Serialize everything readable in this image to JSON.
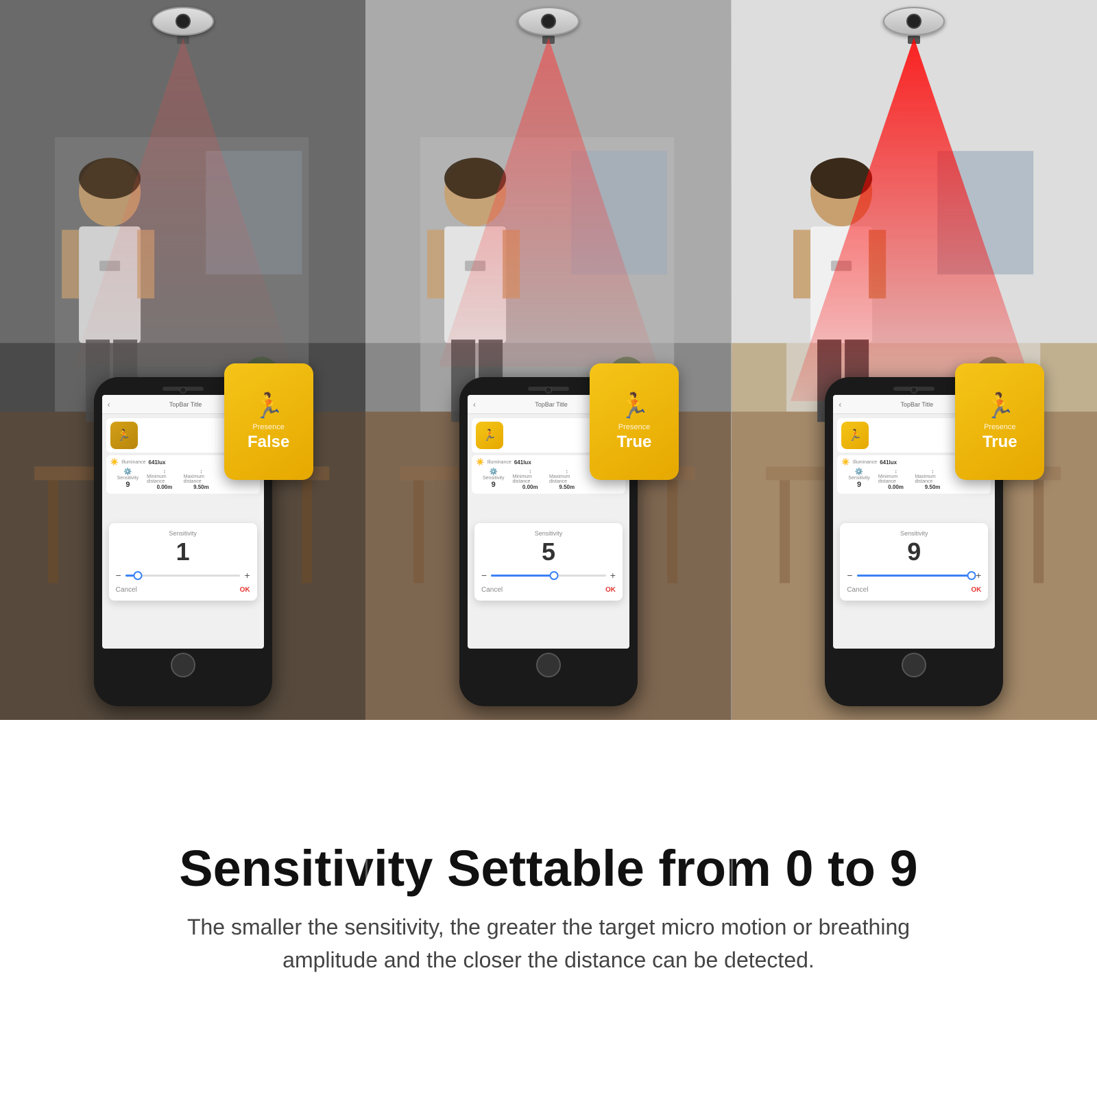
{
  "panels": [
    {
      "id": "panel-1",
      "presence_label": "Presence",
      "presence_value": "False",
      "presence_state": false,
      "sensitivity_title": "Sensitivity",
      "sensitivity_value": "1",
      "slider_percent": 11,
      "topbar_title": "TopBar Title",
      "btn_cancel": "Cancel",
      "btn_ok": "OK",
      "settings": {
        "illuminance_label": "Illuminance",
        "illuminance_value": "641lux",
        "sensitivity_label": "Sensitivity",
        "sensitivity_val": "9",
        "min_distance_label": "Minimum distance",
        "min_distance_val": "0.00m",
        "max_distance_label": "Maximum distance",
        "max_distance_val": "9.50m"
      }
    },
    {
      "id": "panel-2",
      "presence_label": "Presence",
      "presence_value": "True",
      "presence_state": true,
      "sensitivity_title": "Sensitivity",
      "sensitivity_value": "5",
      "slider_percent": 55,
      "topbar_title": "TopBar Title",
      "btn_cancel": "Cancel",
      "btn_ok": "OK",
      "settings": {
        "illuminance_label": "Illuminance",
        "illuminance_value": "641lux",
        "sensitivity_label": "Sensitivity",
        "sensitivity_val": "9",
        "min_distance_label": "Minimum distance",
        "min_distance_val": "0.00m",
        "max_distance_label": "Maximum distance",
        "max_distance_val": "9.50m"
      }
    },
    {
      "id": "panel-3",
      "presence_label": "Presence",
      "presence_value": "True",
      "presence_state": true,
      "sensitivity_title": "Sensitivity",
      "sensitivity_value": "9",
      "slider_percent": 100,
      "topbar_title": "TopBar Title",
      "btn_cancel": "Cancel",
      "btn_ok": "OK",
      "settings": {
        "illuminance_label": "Illuminance",
        "illuminance_value": "641lux",
        "sensitivity_label": "Sensitivity",
        "sensitivity_val": "9",
        "min_distance_label": "Minimum distance",
        "min_distance_val": "0.00m",
        "max_distance_label": "Maximum distance",
        "max_distance_val": "9.50m"
      }
    }
  ],
  "bottom": {
    "main_title": "Sensitivity Settable from 0 to 9",
    "sub_text": "The smaller the sensitivity, the greater the target micro motion or breathing\namplitude and the closer the distance can be detected."
  }
}
